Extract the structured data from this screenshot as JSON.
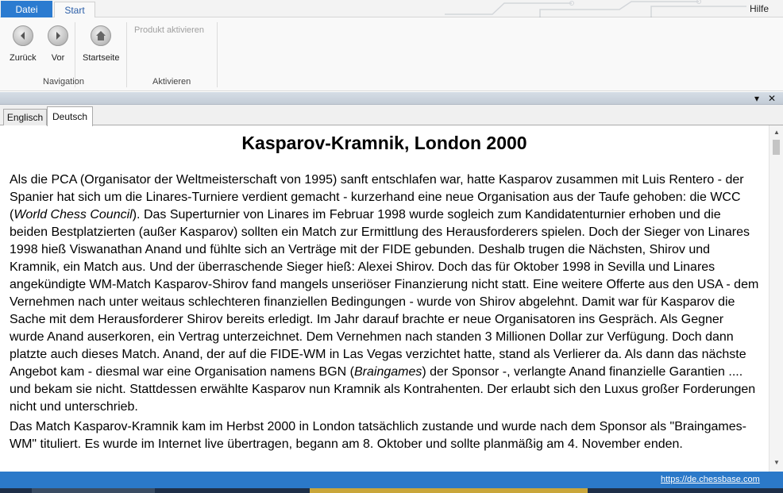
{
  "ribbon_tabs": {
    "datei": "Datei",
    "start": "Start",
    "hilfe": "Hilfe"
  },
  "ribbon": {
    "back": "Zurück",
    "forward": "Vor",
    "home": "Startseite",
    "activate_product": "Produkt aktivieren",
    "group_navigation": "Navigation",
    "group_activate": "Aktivieren"
  },
  "pane": {
    "dropdown_glyph": "▾",
    "close_glyph": "✕"
  },
  "language_tabs": [
    "Englisch",
    "Deutsch"
  ],
  "article": {
    "title": "Kasparov-Kramnik, London 2000",
    "p1_a": "Als die PCA (Organisator der Weltmeisterschaft von 1995) sanft entschlafen war, hatte Kasparov zusammen mit Luis Rentero - der Spanier hat sich um die Linares-Turniere verdient gemacht - kurzerhand eine neue Organisation aus der Taufe gehoben: die WCC (",
    "p1_wcc": "World Chess Council",
    "p1_b": "). Das Superturnier von Linares im Februar 1998 wurde sogleich zum Kandidatenturnier erhoben und die beiden Bestplatzierten (außer Kasparov) sollten ein Match zur Ermittlung des Herausforderers spielen. Doch der Sieger von Linares 1998 hieß Viswanathan Anand und fühlte sich an Verträge mit der FIDE gebunden. Deshalb trugen die Nächsten, Shirov und Kramnik, ein Match aus. Und der überraschende Sieger hieß: Alexei Shirov. Doch das für Oktober 1998 in Sevilla und Linares angekündigte WM-Match Kasparov-Shirov fand mangels unseriöser Finanzierung nicht statt. Eine weitere Offerte aus den USA - dem Vernehmen nach unter weitaus schlechteren finanziellen Bedingungen - wurde von Shirov abgelehnt. Damit war für Kasparov die Sache mit dem Herausforderer Shirov bereits erledigt. Im Jahr darauf brachte er neue Organisatoren ins Gespräch. Als Gegner wurde Anand auserkoren, ein Vertrag unterzeichnet. Dem Vernehmen nach standen 3 Millionen Dollar zur Verfügung. Doch dann platzte auch dieses Match. Anand, der auf die FIDE-WM in Las Vegas verzichtet hatte, stand als Verlierer da. Als dann das nächste Angebot kam - diesmal war eine Organisation namens BGN (",
    "p1_braingames": "Braingames",
    "p1_c": ") der Sponsor -, verlangte Anand finanzielle Garantien .... und bekam sie nicht. Stattdessen erwählte Kasparov nun Kramnik als Kontrahenten. Der erlaubt sich den Luxus großer Forderungen nicht und unterschrieb.",
    "p2": "Das Match Kasparov-Kramnik kam im Herbst 2000 in London tatsächlich zustande und wurde nach dem Sponsor als \"Braingames-WM\" tituliert. Es wurde im Internet live übertragen, begann am 8. Oktober und sollte planmäßig am 4. November enden."
  },
  "status": {
    "link": "https://de.chessbase.com"
  },
  "colors": {
    "accent": "#2b7bd0",
    "statusbar": "#2b79c9"
  }
}
